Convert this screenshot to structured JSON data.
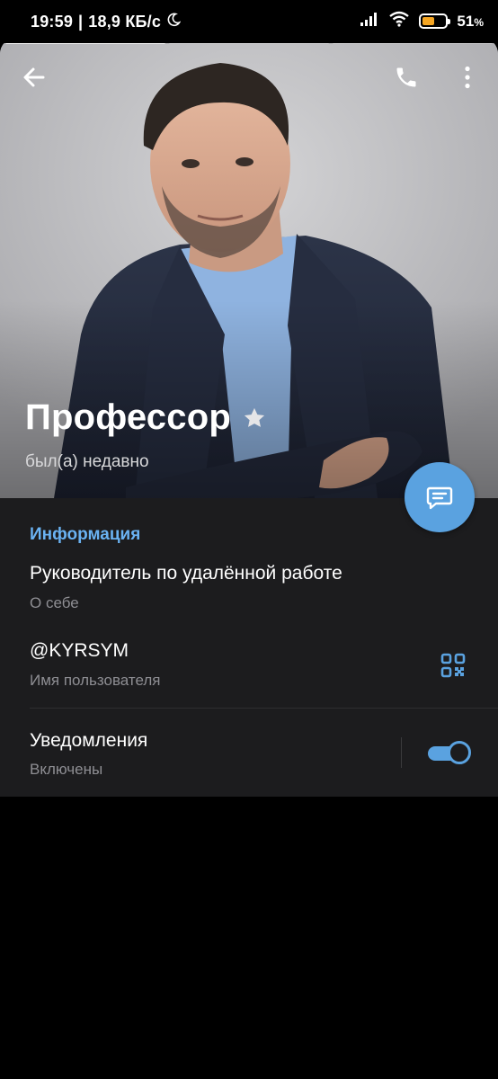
{
  "status_bar": {
    "time": "19:59",
    "separator": "|",
    "speed": "18,9 КБ/с",
    "battery_percent": "51",
    "battery_unit": "%",
    "battery_level": 0.51,
    "battery_color": "#f5a623"
  },
  "stories": {
    "count": 3,
    "active_index": 0
  },
  "header": {
    "back_icon": "arrow-left-icon",
    "call_icon": "phone-icon",
    "more_icon": "more-vertical-icon"
  },
  "profile": {
    "name": "Профессор",
    "badge_icon": "star-icon",
    "last_seen": "был(а) недавно"
  },
  "fab": {
    "icon": "message-icon",
    "color": "#5aa2e0"
  },
  "info": {
    "section_title": "Информация",
    "bio_value": "Руководитель по удалённой работе",
    "bio_label": "О себе",
    "username_value": "@KYRSYM",
    "username_label": "Имя пользователя",
    "qr_icon": "qr-code-icon",
    "notifications_title": "Уведомления",
    "notifications_state": "Включены",
    "notifications_enabled": true
  },
  "colors": {
    "accent": "#6ab2f2",
    "panel_bg": "#1c1c1e",
    "secondary_text": "#8e8e93"
  }
}
